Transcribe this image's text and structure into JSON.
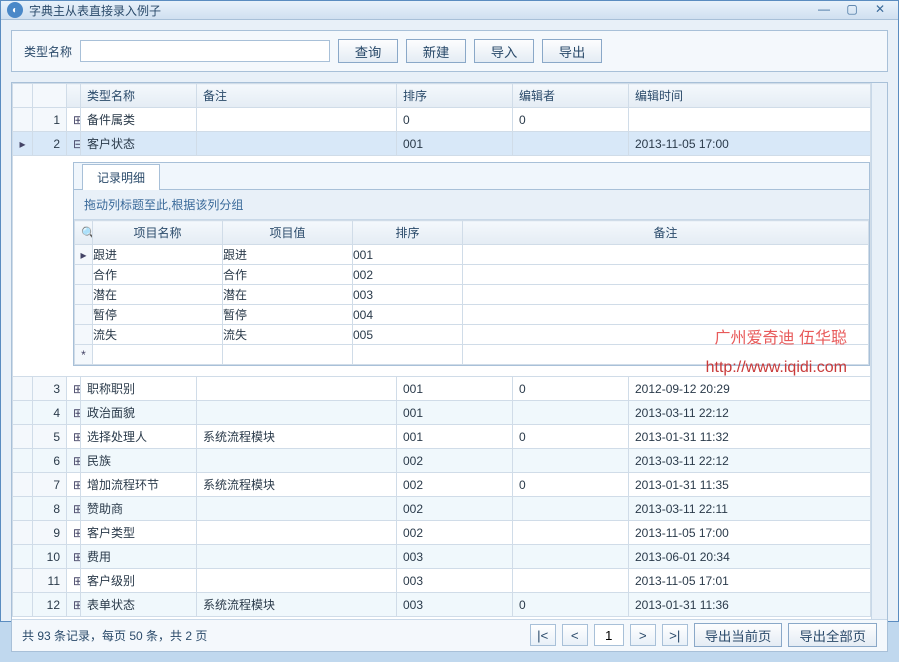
{
  "window": {
    "title": "字典主从表直接录入例子"
  },
  "search": {
    "label": "类型名称",
    "value": "",
    "btn_query": "查询",
    "btn_new": "新建",
    "btn_import": "导入",
    "btn_export": "导出"
  },
  "grid": {
    "columns": [
      "类型名称",
      "备注",
      "排序",
      "编辑者",
      "编辑时间"
    ],
    "rows": [
      {
        "idx": "1",
        "expand": "+",
        "name": "备件属类",
        "remark": "",
        "sort": "0",
        "editor": "0",
        "time": ""
      },
      {
        "idx": "2",
        "expand": "-",
        "name": "客户状态",
        "remark": "",
        "sort": "001",
        "editor": "",
        "time": "2013-11-05 17:00",
        "selected": true,
        "indicator": "▸"
      },
      {
        "idx": "3",
        "expand": "+",
        "name": "职称职别",
        "remark": "",
        "sort": "001",
        "editor": "0",
        "time": "2012-09-12 20:29"
      },
      {
        "idx": "4",
        "expand": "+",
        "name": "政治面貌",
        "remark": "",
        "sort": "001",
        "editor": "",
        "time": "2013-03-11 22:12"
      },
      {
        "idx": "5",
        "expand": "+",
        "name": "选择处理人",
        "remark": "系统流程模块",
        "sort": "001",
        "editor": "0",
        "time": "2013-01-31 11:32"
      },
      {
        "idx": "6",
        "expand": "+",
        "name": "民族",
        "remark": "",
        "sort": "002",
        "editor": "",
        "time": "2013-03-11 22:12"
      },
      {
        "idx": "7",
        "expand": "+",
        "name": "增加流程环节",
        "remark": "系统流程模块",
        "sort": "002",
        "editor": "0",
        "time": "2013-01-31 11:35"
      },
      {
        "idx": "8",
        "expand": "+",
        "name": "赞助商",
        "remark": "",
        "sort": "002",
        "editor": "",
        "time": "2013-03-11 22:11"
      },
      {
        "idx": "9",
        "expand": "+",
        "name": "客户类型",
        "remark": "",
        "sort": "002",
        "editor": "",
        "time": "2013-11-05 17:00"
      },
      {
        "idx": "10",
        "expand": "+",
        "name": "费用",
        "remark": "",
        "sort": "003",
        "editor": "",
        "time": "2013-06-01 20:34"
      },
      {
        "idx": "11",
        "expand": "+",
        "name": "客户级别",
        "remark": "",
        "sort": "003",
        "editor": "",
        "time": "2013-11-05 17:01"
      },
      {
        "idx": "12",
        "expand": "+",
        "name": "表单状态",
        "remark": "系统流程模块",
        "sort": "003",
        "editor": "0",
        "time": "2013-01-31 11:36"
      }
    ]
  },
  "detail": {
    "tab": "记录明细",
    "group_hint": "拖动列标题至此,根据该列分组",
    "columns": [
      "项目名称",
      "项目值",
      "排序",
      "备注"
    ],
    "rows": [
      {
        "ind": "▸",
        "name": "跟进",
        "value": "跟进",
        "sort": "001",
        "remark": ""
      },
      {
        "ind": "",
        "name": "合作",
        "value": "合作",
        "sort": "002",
        "remark": ""
      },
      {
        "ind": "",
        "name": "潜在",
        "value": "潜在",
        "sort": "003",
        "remark": ""
      },
      {
        "ind": "",
        "name": "暂停",
        "value": "暂停",
        "sort": "004",
        "remark": ""
      },
      {
        "ind": "",
        "name": "流失",
        "value": "流失",
        "sort": "005",
        "remark": ""
      },
      {
        "ind": "*",
        "name": "",
        "value": "",
        "sort": "",
        "remark": ""
      }
    ]
  },
  "watermark": {
    "line1": "广州爱奇迪 伍华聪",
    "line2": "http://www.iqidi.com"
  },
  "status": {
    "info": "共 93 条记录，每页 50 条，共 2 页",
    "first": "|<",
    "prev": "<",
    "page": "1",
    "next": ">",
    "last": ">|",
    "export_page": "导出当前页",
    "export_all": "导出全部页"
  }
}
